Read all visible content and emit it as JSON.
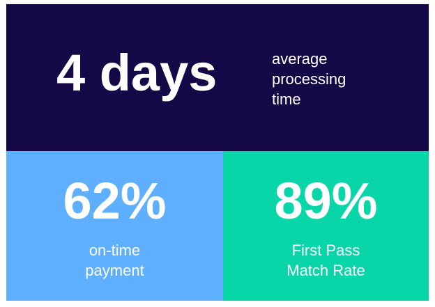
{
  "top": {
    "value": "4 days",
    "label_lines": [
      "average",
      "processing",
      "time"
    ],
    "background": "#140846"
  },
  "metrics": [
    {
      "value": "62%",
      "label_lines": [
        "on-time",
        "payment"
      ],
      "background": "#5eb0ff"
    },
    {
      "value": "89%",
      "label_lines": [
        "First Pass",
        "Match Rate"
      ],
      "background": "#08d5a8"
    }
  ]
}
